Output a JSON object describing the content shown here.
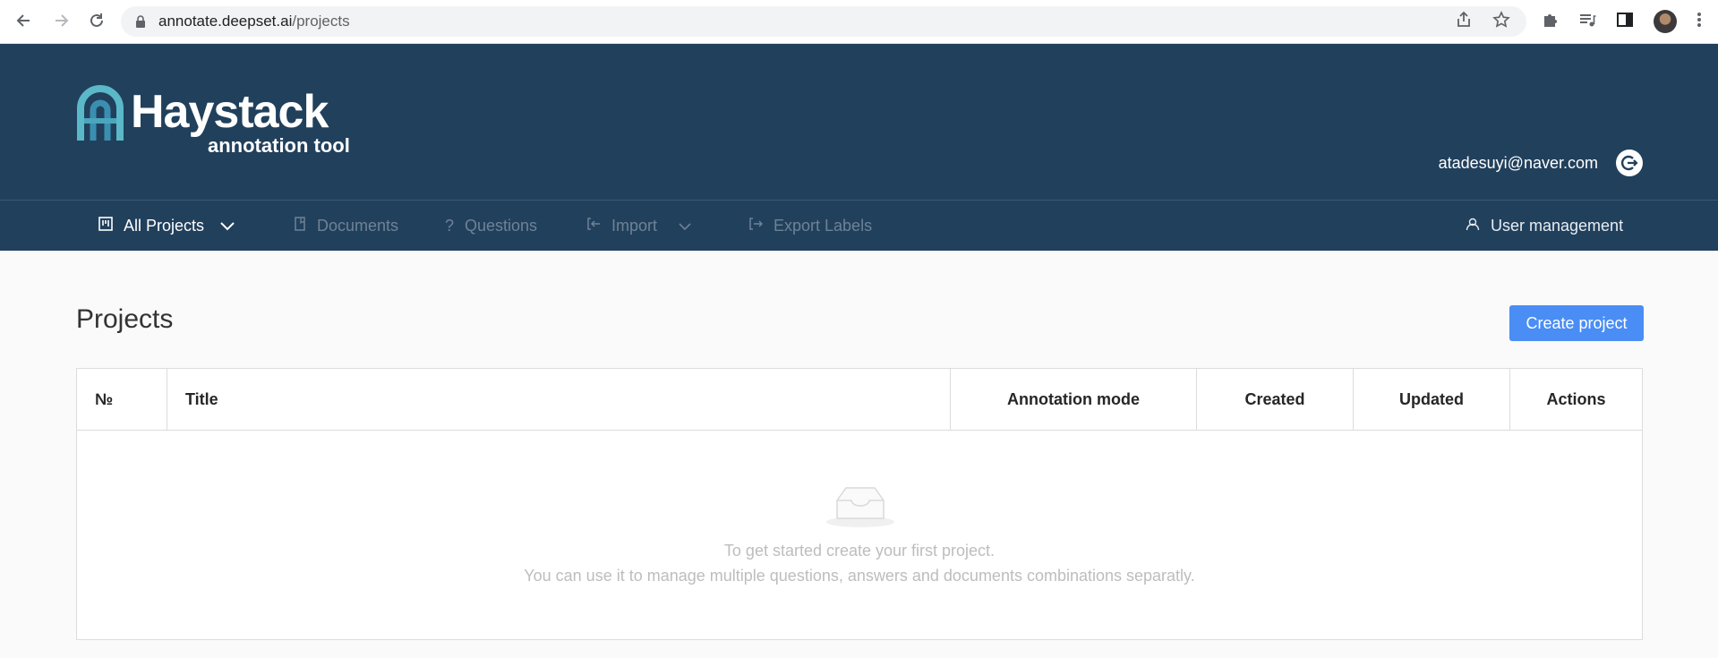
{
  "browser": {
    "url_host": "annotate.deepset.ai",
    "url_path": "/projects"
  },
  "header": {
    "logo_title": "Haystack",
    "logo_subtitle": "annotation tool",
    "user_email": "atadesuyi@naver.com"
  },
  "nav": {
    "all_projects": "All Projects",
    "documents": "Documents",
    "questions": "Questions",
    "import": "Import",
    "export_labels": "Export Labels",
    "user_management": "User management"
  },
  "main": {
    "title": "Projects",
    "create_button": "Create project",
    "table": {
      "columns": [
        "№",
        "Title",
        "Annotation mode",
        "Created",
        "Updated",
        "Actions"
      ]
    },
    "empty_line1": "To get started create your first project.",
    "empty_line2": "You can use it to manage multiple questions, answers and documents combinations separatly."
  },
  "colors": {
    "header_bg": "#21405c",
    "accent": "#4a8df5",
    "disabled_nav": "#6e8296"
  },
  "icons": [
    "back-icon",
    "forward-icon",
    "reload-icon",
    "lock-icon",
    "share-icon",
    "star-icon",
    "extensions-icon",
    "media-icon",
    "sidepanel-icon",
    "menu-icon",
    "board-icon",
    "chevron-down-icon",
    "document-icon",
    "question-icon",
    "import-icon",
    "export-icon",
    "user-icon",
    "logout-icon",
    "inbox-icon"
  ]
}
